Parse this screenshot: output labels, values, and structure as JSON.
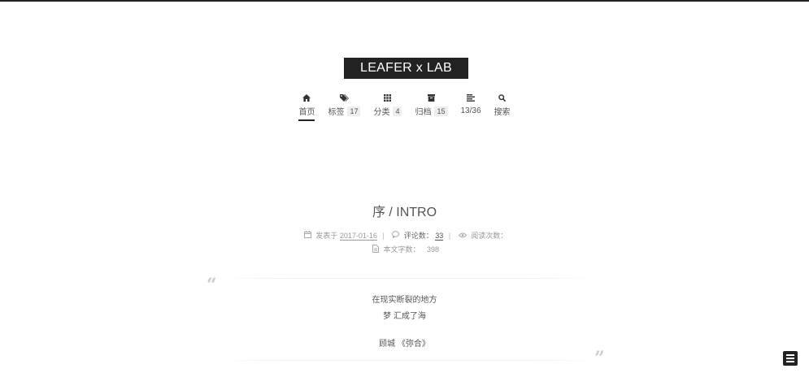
{
  "site": {
    "title": "LEAFER x LAB"
  },
  "nav": {
    "items": [
      {
        "icon": "home-icon",
        "label": "首页",
        "badge": ""
      },
      {
        "icon": "tags-icon",
        "label": "标签",
        "badge": "17"
      },
      {
        "icon": "grid-icon",
        "label": "分类",
        "badge": "4"
      },
      {
        "icon": "archive-icon",
        "label": "归档",
        "badge": "15"
      },
      {
        "icon": "list-icon",
        "label": "13/36",
        "badge": ""
      },
      {
        "icon": "search-icon",
        "label": "搜索",
        "badge": ""
      }
    ]
  },
  "post": {
    "title": "序 / INTRO",
    "meta": {
      "posted_label": "发表于",
      "posted_date": "2017-01-16",
      "comments_label": "评论数：",
      "comments_count": "33",
      "views_label": "阅读次数：",
      "wordcount_label": "本文字数：",
      "wordcount": "398"
    },
    "quote": {
      "line1": "在现实断裂的地方",
      "line2": "梦 汇成了海",
      "attribution": "顾城 《弥合》"
    }
  },
  "colors": {
    "accent": "#222222",
    "muted": "#999999"
  }
}
